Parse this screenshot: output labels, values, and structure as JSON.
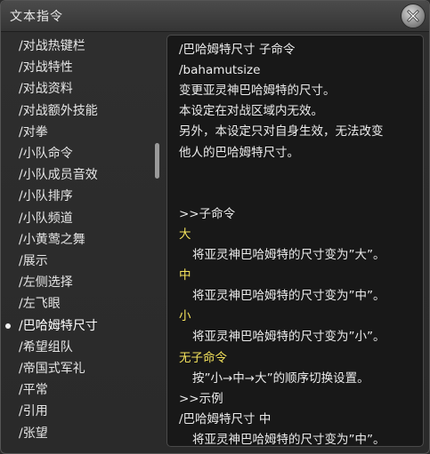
{
  "window": {
    "title": "文本指令",
    "close_icon": "close-x-icon"
  },
  "sidebar": {
    "items": [
      {
        "label": "/对战热键栏"
      },
      {
        "label": "/对战特性"
      },
      {
        "label": "/对战资料"
      },
      {
        "label": "/对战额外技能"
      },
      {
        "label": "/对拳"
      },
      {
        "label": "/小队命令"
      },
      {
        "label": "/小队成员音效"
      },
      {
        "label": "/小队排序"
      },
      {
        "label": "/小队频道"
      },
      {
        "label": "/小黄莺之舞"
      },
      {
        "label": "/展示"
      },
      {
        "label": "/左侧选择"
      },
      {
        "label": "/左飞眼"
      },
      {
        "label": "/巴哈姆特尺寸",
        "selected": true
      },
      {
        "label": "/希望组队"
      },
      {
        "label": "/帝国式军礼"
      },
      {
        "label": "/平常"
      },
      {
        "label": "/引用"
      },
      {
        "label": "/张望"
      }
    ]
  },
  "content": {
    "lines": [
      {
        "text": "/巴哈姆特尺寸 子命令",
        "style": "normal"
      },
      {
        "text": "/bahamutsize",
        "style": "normal"
      },
      {
        "text": "变更亚灵神巴哈姆特的尺寸。",
        "style": "normal"
      },
      {
        "text": "本设定在对战区域内无效。",
        "style": "normal"
      },
      {
        "text": "另外，本设定只对自身生效，无法改变",
        "style": "normal"
      },
      {
        "text": "他人的巴哈姆特尺寸。",
        "style": "normal"
      },
      {
        "text": "",
        "style": "normal"
      },
      {
        "text": "",
        "style": "normal"
      },
      {
        "text": ">>子命令",
        "style": "normal"
      },
      {
        "text": "大",
        "style": "yellow"
      },
      {
        "text": "将亚灵神巴哈姆特的尺寸变为”大”。",
        "style": "indent"
      },
      {
        "text": "中",
        "style": "yellow"
      },
      {
        "text": "将亚灵神巴哈姆特的尺寸变为”中”。",
        "style": "indent"
      },
      {
        "text": "小",
        "style": "yellow"
      },
      {
        "text": "将亚灵神巴哈姆特的尺寸变为”小”。",
        "style": "indent"
      },
      {
        "text": "无子命令",
        "style": "yellow"
      },
      {
        "text": "按”小→中→大”的顺序切换设置。",
        "style": "indent"
      },
      {
        "text": ">>示例",
        "style": "normal"
      },
      {
        "text": "/巴哈姆特尺寸 中",
        "style": "normal"
      },
      {
        "text": "将亚灵神巴哈姆特的尺寸变为”中”。",
        "style": "indent"
      }
    ]
  },
  "colors": {
    "highlight_yellow": "#f3e25c",
    "text": "#ececec",
    "panel_bg": "#181818"
  }
}
